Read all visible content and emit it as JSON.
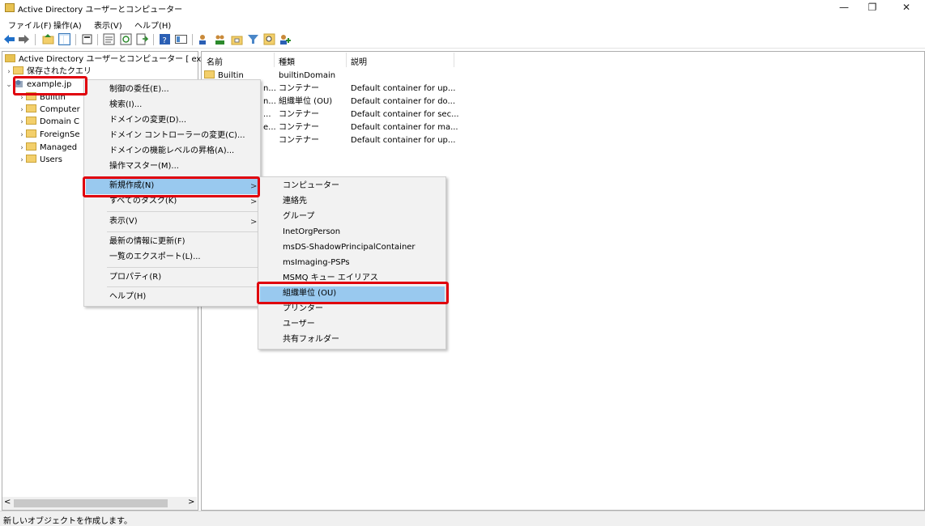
{
  "window": {
    "title": "Active Directory ユーザーとコンピューター",
    "minimize": "—",
    "restore": "❐",
    "close": "✕"
  },
  "menubar": [
    "ファイル(F)",
    "操作(A)",
    "表示(V)",
    "ヘルプ(H)"
  ],
  "toolbar": {
    "icons": [
      "back-arrow-icon",
      "forward-arrow-icon",
      "up-folder-icon",
      "show-tree-icon",
      "copy-icon",
      "properties-icon",
      "refresh-icon",
      "export-list-icon",
      "help-icon",
      "view-icon",
      "users-icon",
      "groups-icon",
      "ou-icon",
      "filter-icon",
      "find-icon",
      "add-to-group-icon"
    ]
  },
  "tree": {
    "root_label": "Active Directory ユーザーとコンピューター [ example-",
    "saved_queries": "保存されたクエリ",
    "domain": "example.jp",
    "children": [
      "Builtin",
      "Computer",
      "Domain C",
      "ForeignSe",
      "Managed",
      "Users"
    ]
  },
  "list": {
    "columns": [
      "名前",
      "種類",
      "説明"
    ],
    "rows": [
      {
        "name": "Builtin",
        "type": "builtinDomain",
        "desc": ""
      },
      {
        "name": "n...",
        "type": "コンテナー",
        "desc": "Default container for up..."
      },
      {
        "name": "n...",
        "type": "組織単位 (OU)",
        "desc": "Default container for do..."
      },
      {
        "name": "...",
        "type": "コンテナー",
        "desc": "Default container for sec..."
      },
      {
        "name": "e...",
        "type": "コンテナー",
        "desc": "Default container for ma..."
      },
      {
        "name": "",
        "type": "コンテナー",
        "desc": "Default container for up..."
      }
    ]
  },
  "context_menu": {
    "items_top": [
      "制御の委任(E)...",
      "検索(I)...",
      "ドメインの変更(D)...",
      "ドメイン コントローラーの変更(C)...",
      "ドメインの機能レベルの昇格(A)...",
      "操作マスター(M)..."
    ],
    "new": "新規作成(N)",
    "all_tasks": "すべてのタスク(K)",
    "view": "表示(V)",
    "refresh": "最新の情報に更新(F)",
    "export": "一覧のエクスポート(L)...",
    "properties": "プロパティ(R)",
    "help": "ヘルプ(H)",
    "arrow": ">"
  },
  "submenu": {
    "items": [
      "コンピューター",
      "連絡先",
      "グループ",
      "InetOrgPerson",
      "msDS-ShadowPrincipalContainer",
      "msImaging-PSPs",
      "MSMQ キュー エイリアス",
      "組織単位 (OU)",
      "プリンター",
      "ユーザー",
      "共有フォルダー"
    ],
    "highlighted_index": 7
  },
  "scroll": {
    "left": "<",
    "right": ">"
  },
  "status": "新しいオブジェクトを作成します。",
  "colors": {
    "highlight": "#99c9ef",
    "callout": "#e0000d"
  }
}
